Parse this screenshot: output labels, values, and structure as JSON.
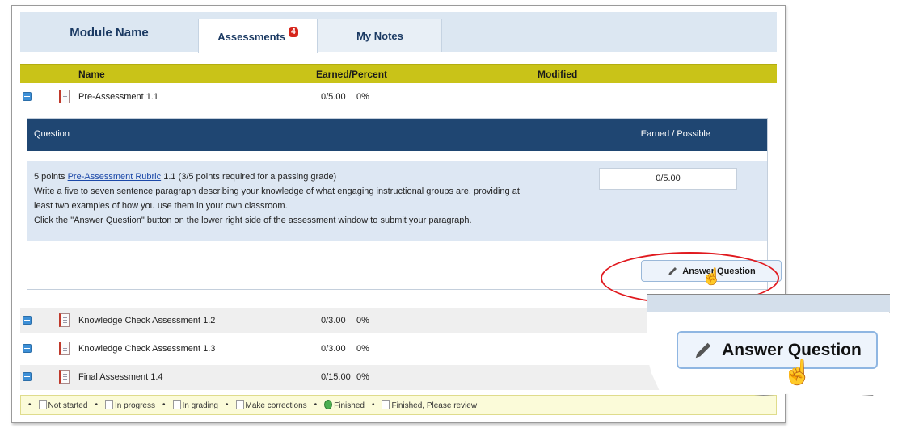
{
  "tabs": {
    "module_name": "Module Name",
    "assessments": "Assessments",
    "assessments_badge": "4",
    "my_notes": "My Notes"
  },
  "columns": {
    "name": "Name",
    "earned_percent": "Earned/Percent",
    "modified": "Modified"
  },
  "assessments": [
    {
      "name": "Pre-Assessment 1.1",
      "score": "0/5.00",
      "percent": "0%",
      "expanded": true
    },
    {
      "name": "Knowledge Check Assessment 1.2",
      "score": "0/3.00",
      "percent": "0%",
      "expanded": false
    },
    {
      "name": "Knowledge Check Assessment 1.3",
      "score": "0/3.00",
      "percent": "0%",
      "expanded": false
    },
    {
      "name": "Final Assessment 1.4",
      "score": "0/15.00",
      "percent": "0%",
      "expanded": false
    }
  ],
  "question_panel": {
    "header_question": "Question",
    "header_earned": "Earned / Possible",
    "points_prefix": "5 points",
    "rubric_link": "Pre-Assessment Rubric",
    "points_suffix": "1.1 (3/5 points required for a passing grade)",
    "line1": "Write a five to seven sentence paragraph describing your knowledge of what engaging instructional groups are, providing at",
    "line2": "least two examples of how you use them in your own classroom.",
    "line3": "Click the \"Answer Question\" button on the lower right side of the assessment window to submit your paragraph.",
    "score": "0/5.00",
    "answer_button": "Answer Question"
  },
  "legend": {
    "not_started": "Not started",
    "in_progress": "In progress",
    "in_grading": "In grading",
    "make_corrections": "Make corrections",
    "finished": "Finished",
    "finished_review": "Finished, Please review"
  },
  "callout": {
    "zoom_button_label": "Answer Question",
    "highlight_color": "#e0191e"
  },
  "colors": {
    "header_bar": "#c9c318",
    "question_header": "#1f4672",
    "question_body": "#dde7f3",
    "badge": "#d6251b"
  }
}
